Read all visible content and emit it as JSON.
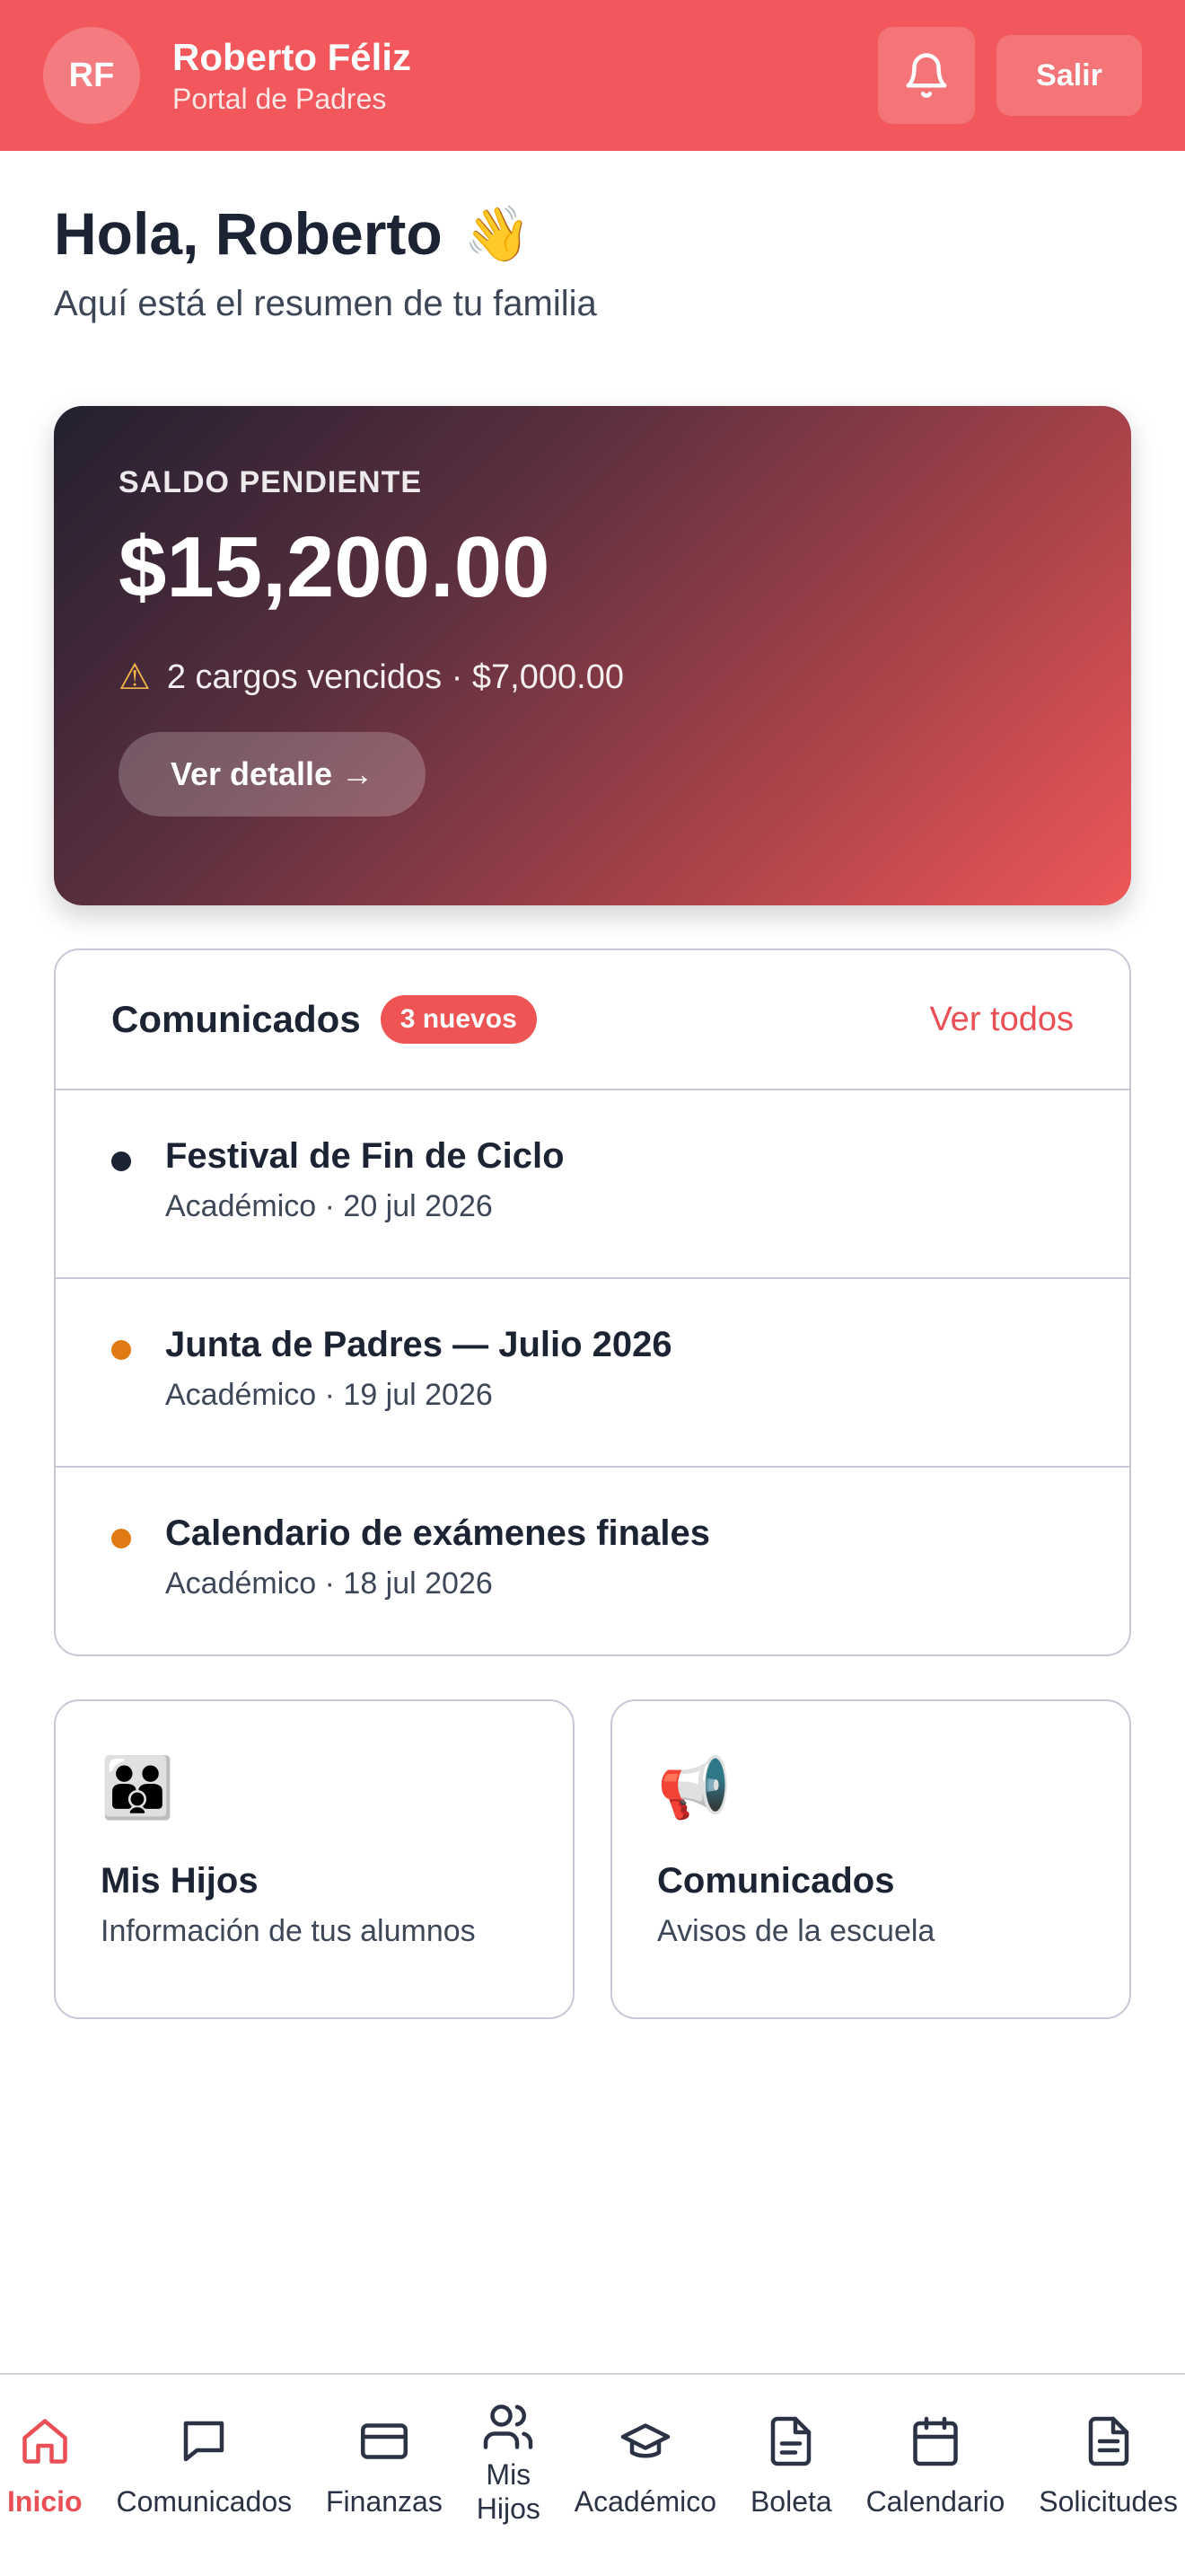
{
  "header": {
    "avatar_initials": "RF",
    "user_name": "Roberto Féliz",
    "user_role": "Portal de Padres",
    "logout_label": "Salir",
    "accent_color": "#f1575b"
  },
  "greeting": {
    "title": "Hola, Roberto",
    "emoji": "👋",
    "subtitle": "Aquí está el resumen de tu familia"
  },
  "balance": {
    "label": "SALDO PENDIENTE",
    "amount": "$15,200.00",
    "warning_icon": "⚠",
    "warning": "2 cargos vencidos · $7,000.00",
    "detail_label": "Ver detalle →"
  },
  "announcements": {
    "title": "Comunicados",
    "badge": "3 nuevos",
    "view_all": "Ver todos",
    "items": [
      {
        "title": "Festival de Fin de Ciclo",
        "meta": "Académico · 20 jul 2026",
        "dot_color": "#1c2333"
      },
      {
        "title": "Junta de Padres — Julio 2026",
        "meta": "Académico · 19 jul 2026",
        "dot_color": "#e07a12"
      },
      {
        "title": "Calendario de exámenes finales",
        "meta": "Académico · 18 jul 2026",
        "dot_color": "#e07a12"
      }
    ]
  },
  "tiles": [
    {
      "icon": "👪",
      "title": "Mis Hijos",
      "subtitle": "Información de tus alumnos"
    },
    {
      "icon": "📢",
      "title": "Comunicados",
      "subtitle": "Avisos de la escuela"
    }
  ],
  "bottom_nav": {
    "items": [
      {
        "label": "Inicio",
        "icon": "home-icon",
        "active": true
      },
      {
        "label": "Comunicados",
        "icon": "chat-icon"
      },
      {
        "label": "Finanzas",
        "icon": "credit-card-icon"
      },
      {
        "label": "Mis\nHijos",
        "icon": "users-icon"
      },
      {
        "label": "Académico",
        "icon": "graduation-cap-icon"
      },
      {
        "label": "Boleta",
        "icon": "document-icon"
      },
      {
        "label": "Calendario",
        "icon": "calendar-icon"
      },
      {
        "label": "Solicitudes",
        "icon": "file-text-icon"
      }
    ]
  }
}
